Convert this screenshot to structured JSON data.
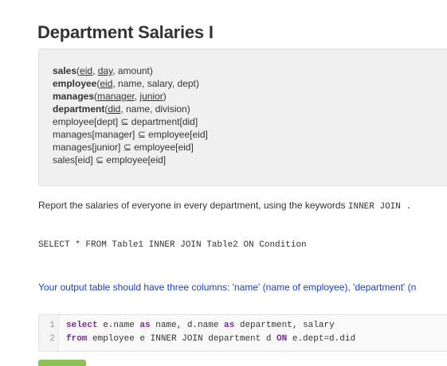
{
  "page": {
    "title": "Department Salaries I"
  },
  "schema": {
    "sales": {
      "name": "sales",
      "open": "(",
      "k1": "eid",
      "sep1": ", ",
      "k2": "day",
      "rest": ", amount)"
    },
    "employee": {
      "name": "employee",
      "open": "(",
      "k1": "eid",
      "rest": ", name, salary, dept)"
    },
    "manages": {
      "name": "manages",
      "open": "(",
      "k1": "manager",
      "sep1": ", ",
      "k2": "junior",
      "close": ")"
    },
    "department": {
      "name": "department",
      "open": "(",
      "k1": "did",
      "rest": ", name, division)"
    },
    "constraints": [
      "employee[dept] ⊆ department[did]",
      "manages[manager] ⊆ employee[eid]",
      "manages[junior] ⊆ employee[eid]",
      "sales[eid] ⊆ employee[eid]"
    ]
  },
  "instructions": {
    "report_text": "Report the salaries of everyone in every department, using the keywords ",
    "report_keyword": "INNER JOIN .",
    "example_sql": "SELECT * FROM Table1 INNER JOIN Table2 ON Condition",
    "output_note": "Your output table should have three columns: 'name' (name of employee), 'department' (n"
  },
  "editor": {
    "line_numbers": [
      "1",
      "2"
    ],
    "line1": {
      "kw1": "select",
      "t1": " e.name ",
      "kw2": "as",
      "t2": " name, d.name ",
      "kw3": "as",
      "t3": " department, salary"
    },
    "line2": {
      "kw1": "from",
      "t1": " employee e INNER JOIN department d ",
      "kw2": "ON",
      "t2": " e.dept=d.did"
    }
  }
}
